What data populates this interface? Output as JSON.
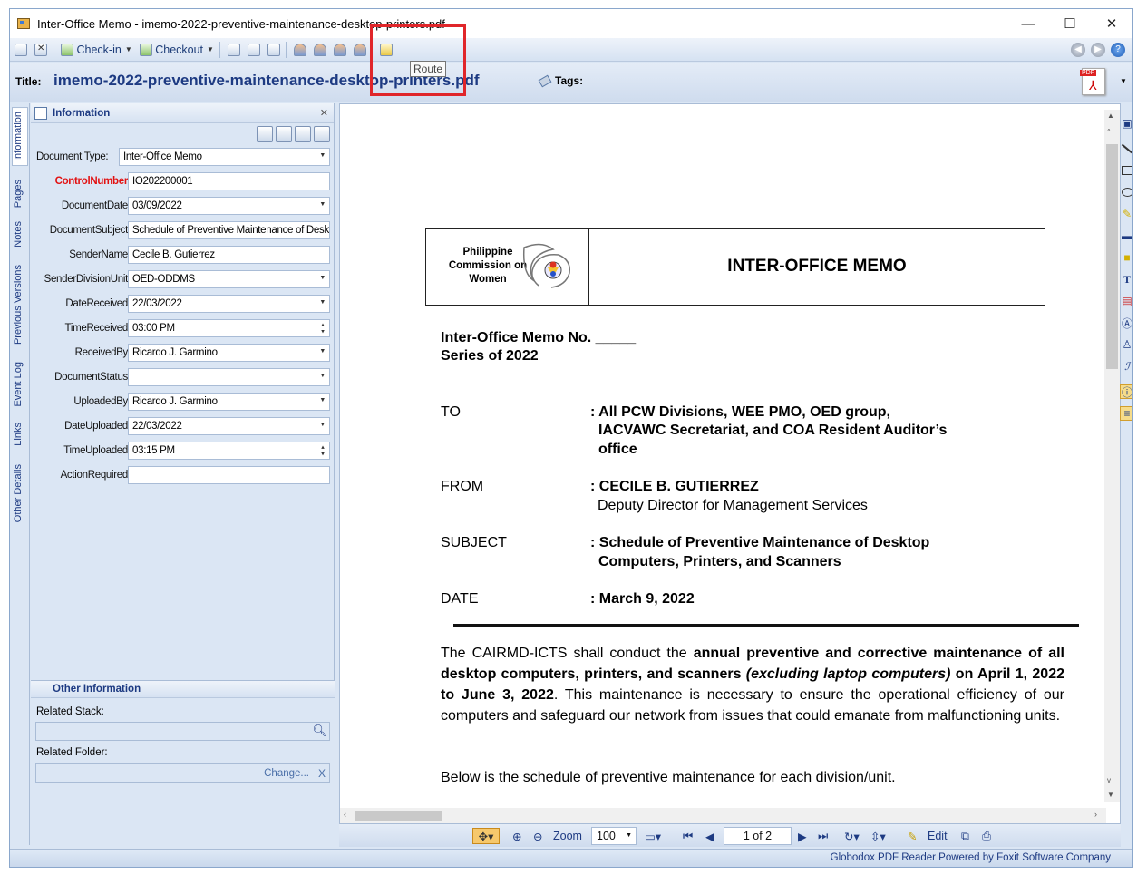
{
  "window": {
    "title": "Inter-Office Memo - imemo-2022-preventive-maintenance-desktop-printers.pdf",
    "minimize": "—",
    "maximize": "☐",
    "close": "✕"
  },
  "toolbar": {
    "checkin": "Check-in",
    "checkout": "Checkout",
    "tooltip": "Route"
  },
  "title_row": {
    "label": "Title:",
    "value": "imemo-2022-preventive-maintenance-desktop-printers.pdf",
    "tags_label": "Tags:",
    "pdf_badge": "PDF"
  },
  "side_tabs": [
    "Information",
    "Pages",
    "Notes",
    "Previous Versions",
    "Event Log",
    "Links",
    "Other Details"
  ],
  "info_panel": {
    "title": "Information",
    "doc_type_label": "Document Type:",
    "doc_type_value": "Inter-Office Memo",
    "fields": [
      {
        "label": "ControlNumber",
        "value": "IO202200001"
      },
      {
        "label": "DocumentDate",
        "value": "03/09/2022"
      },
      {
        "label": "DocumentSubject",
        "value": "Schedule of Preventive Maintenance of Desktop"
      },
      {
        "label": "SenderName",
        "value": "Cecile B. Gutierrez"
      },
      {
        "label": "SenderDivisionUnit",
        "value": "OED-ODDMS"
      },
      {
        "label": "DateReceived",
        "value": "22/03/2022"
      },
      {
        "label": "TimeReceived",
        "value": "03:00 PM"
      },
      {
        "label": "ReceivedBy",
        "value": "Ricardo J. Garmino"
      },
      {
        "label": "DocumentStatus",
        "value": ""
      },
      {
        "label": "UploadedBy",
        "value": "Ricardo J. Garmino"
      },
      {
        "label": "DateUploaded",
        "value": "22/03/2022"
      },
      {
        "label": "TimeUploaded",
        "value": "03:15 PM"
      },
      {
        "label": "ActionRequired",
        "value": ""
      }
    ],
    "other_title": "Other Information",
    "related_stack_label": "Related Stack:",
    "related_folder_label": "Related Folder:",
    "change_label": "Change...",
    "clear_label": "X"
  },
  "document": {
    "org": "Philippine Commission on Women",
    "memo_title": "INTER-OFFICE MEMO",
    "memo_no": "Inter-Office Memo No. _____",
    "series": "Series of 2022",
    "to_label": "TO",
    "to_line1": ": All PCW Divisions, WEE PMO, OED group,",
    "to_line2": "IACVAWC Secretariat, and COA Resident Auditor’s",
    "to_line3": "office",
    "from_label": "FROM",
    "from_line1": ": CECILE B. GUTIERREZ",
    "from_line2": "Deputy Director for Management Services",
    "subject_label": "SUBJECT",
    "subject_line1": ": Schedule of Preventive Maintenance of Desktop",
    "subject_line2": "Computers,  Printers, and Scanners",
    "date_label": "DATE",
    "date_value": ": March 9, 2022",
    "p1_a": "The CAIRMD-ICTS shall conduct the ",
    "p1_b": "annual preventive and corrective maintenance of all desktop computers, printers, and scanners ",
    "p1_c": "(excluding laptop computers)",
    "p1_d": " on April 1, 2022 to June 3, 2022",
    "p1_e": ". This maintenance is necessary to ensure the operational efficiency of our computers and safeguard our network from issues that could emanate from malfunctioning units.",
    "p2": "Below is the schedule of preventive maintenance for each division/unit."
  },
  "pdf_toolbar": {
    "zoom_label": "Zoom",
    "zoom_value": "100",
    "page_value": "1 of 2",
    "edit_label": "Edit"
  },
  "status": {
    "text": "Globodox PDF Reader Powered by Foxit Software Company"
  }
}
